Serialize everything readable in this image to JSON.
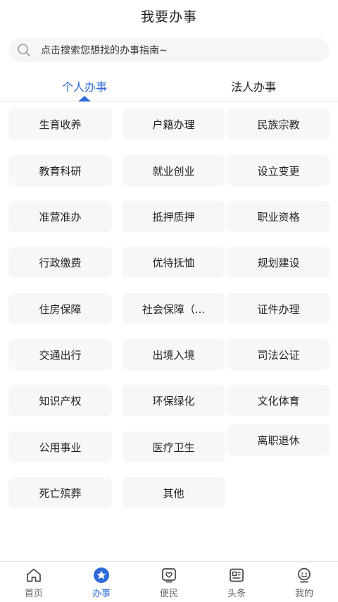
{
  "header": {
    "title": "我要办事"
  },
  "search": {
    "placeholder": "点击搜索您想找的办事指南~"
  },
  "tabs": [
    {
      "label": "个人办事",
      "active": true
    },
    {
      "label": "法人办事",
      "active": false
    }
  ],
  "services": [
    "生育收养",
    "户籍办理",
    "民族宗教",
    "教育科研",
    "就业创业",
    "设立变更",
    "准营准办",
    "抵押质押",
    "职业资格",
    "行政缴费",
    "优待抚恤",
    "规划建设",
    "住房保障",
    "社会保障（...",
    "证件办理",
    "交通出行",
    "出境入境",
    "司法公证",
    "知识产权",
    "环保绿化",
    "文化体育",
    "公用事业",
    "医疗卫生",
    "离职退休",
    "死亡殡葬",
    "其他"
  ],
  "bottom_nav": [
    {
      "label": "首页",
      "icon": "home-icon",
      "active": false
    },
    {
      "label": "办事",
      "icon": "star-badge-icon",
      "active": true
    },
    {
      "label": "便民",
      "icon": "heart-card-icon",
      "active": false
    },
    {
      "label": "头条",
      "icon": "news-icon",
      "active": false
    },
    {
      "label": "我的",
      "icon": "profile-icon",
      "active": false
    }
  ],
  "colors": {
    "accent": "#2f6bd8",
    "cell_bg": "#f6f7f9",
    "search_bg": "#f5f6f8"
  }
}
